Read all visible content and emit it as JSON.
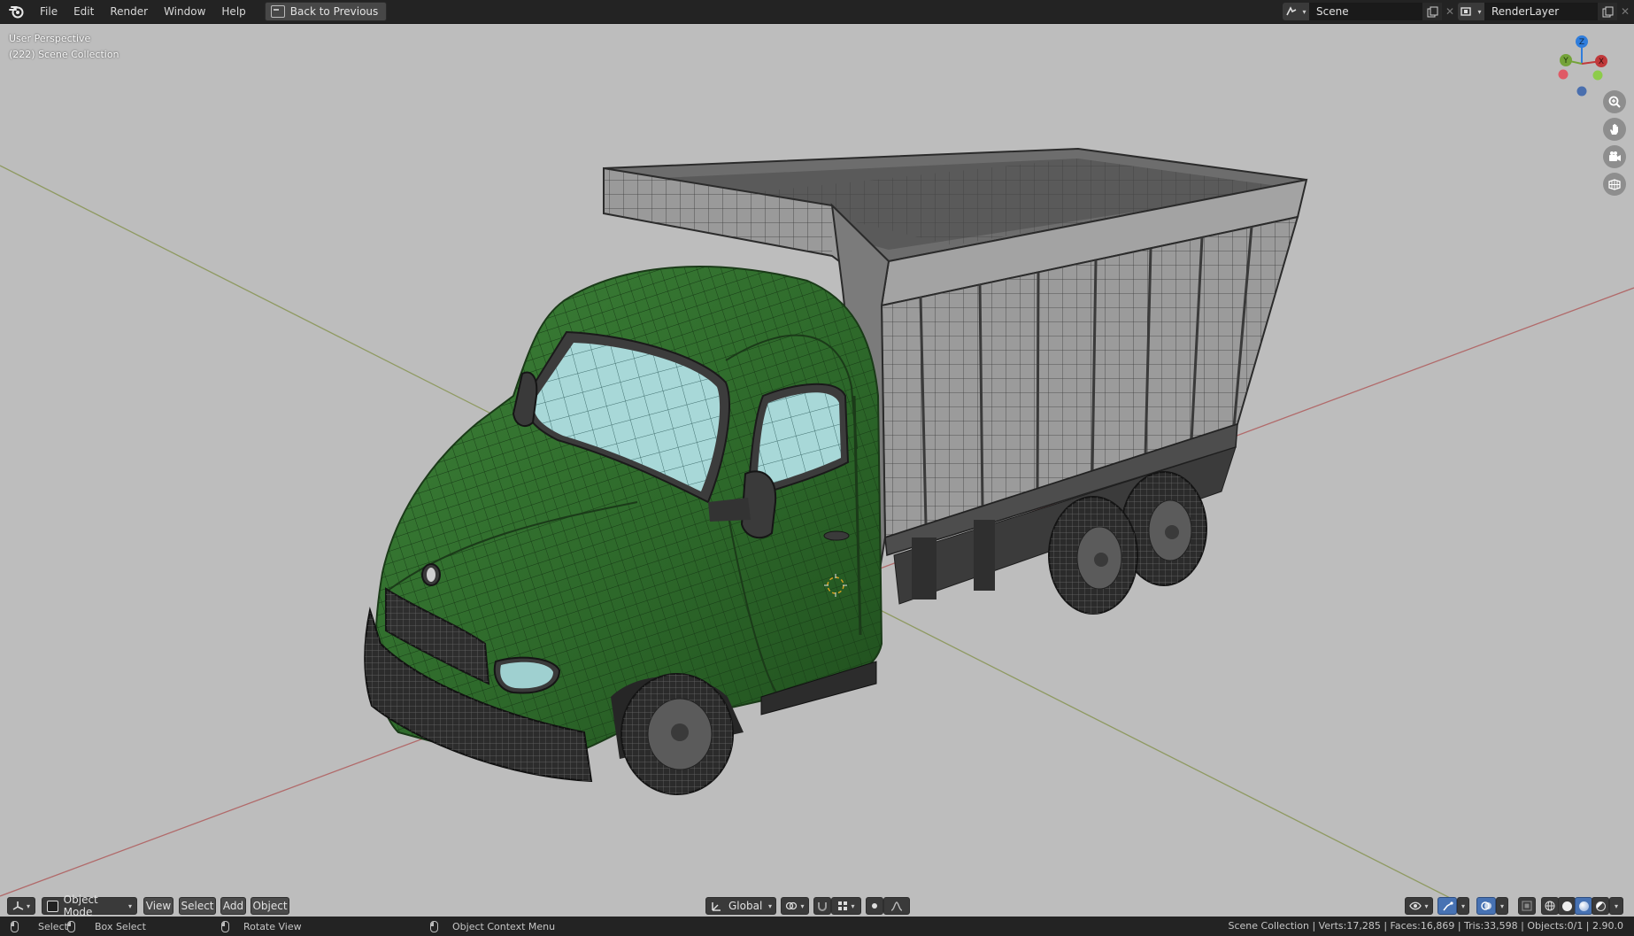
{
  "menu": {
    "items": [
      "File",
      "Edit",
      "Render",
      "Window",
      "Help"
    ],
    "back_button": "Back to Previous"
  },
  "scene_selector": {
    "value": "Scene"
  },
  "view_layer_selector": {
    "value": "RenderLayer"
  },
  "viewport": {
    "view_name": "User Perspective",
    "collection_info": "(222) Scene Collection",
    "gizmo_axes": {
      "x": "X",
      "y": "Y",
      "z": "Z"
    }
  },
  "viewport_header": {
    "mode": "Object Mode",
    "menus": [
      "View",
      "Select",
      "Add",
      "Object"
    ],
    "transform_orientation": "Global"
  },
  "statusbar": {
    "select": "Select",
    "box_select": "Box Select",
    "rotate_view": "Rotate View",
    "context_menu": "Object Context Menu",
    "stats": "Scene Collection | Verts:17,285 | Faces:16,869 | Tris:33,598 | Objects:0/1 | 2.90.0"
  },
  "colors": {
    "viewport_bg": "#bdbdbd",
    "truck_cab": "#2f6a2c",
    "truck_bed": "#8c8c8c",
    "glass": "#9fd3d3",
    "axis_x": "#c0393b",
    "axis_y": "#74a339",
    "axis_z": "#2f7ddc"
  }
}
